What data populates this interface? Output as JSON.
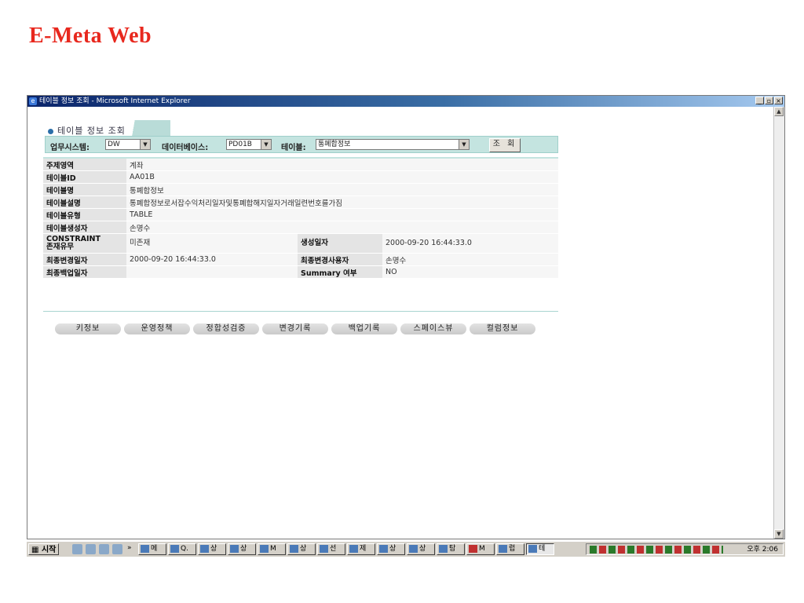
{
  "slide": {
    "title": "E-Meta Web"
  },
  "window": {
    "title": "테이블 정보 조회 - Microsoft Internet Explorer",
    "controls": {
      "minimize": "_",
      "maximize": "▫",
      "close": "×"
    }
  },
  "section": {
    "title": "테이블 정보 조회"
  },
  "search": {
    "system_label": "업무시스템:",
    "system_value": "DW",
    "db_label": "데이터베이스:",
    "db_value": "PD01B",
    "table_label": "테이블:",
    "table_value": "통폐합정보",
    "query_button": "조 회"
  },
  "info": {
    "subject_area": {
      "label": "주제영역",
      "value": "계좌"
    },
    "table_id": {
      "label": "테이블ID",
      "value": "AA01B"
    },
    "table_name": {
      "label": "테이블명",
      "value": "통폐합정보"
    },
    "table_desc": {
      "label": "테이블설명",
      "value": "통폐합정보로서잡수익처리일자및통폐합해지일자거래일련번호를가짐"
    },
    "table_type": {
      "label": "테이블유형",
      "value": "TABLE"
    },
    "creator": {
      "label": "테이블생성자",
      "value": "손명수"
    },
    "constraint": {
      "label_line1": "CONSTRAINT",
      "label_line2": "존재유무",
      "value": "미존재"
    },
    "created_date": {
      "label": "생성일자",
      "value": "2000-09-20 16:44:33.0"
    },
    "modified_date": {
      "label": "최종변경일자",
      "value": "2000-09-20 16:44:33.0"
    },
    "modified_user": {
      "label": "최종변경사용자",
      "value": "손명수"
    },
    "backup_date": {
      "label": "최종백업일자",
      "value": ""
    },
    "summary": {
      "label": "Summary 여부",
      "value": "NO"
    }
  },
  "tabs": [
    "키정보",
    "운영정책",
    "정합성검증",
    "변경기록",
    "백업기록",
    "스페이스뷰",
    "컬럼정보"
  ],
  "taskbar": {
    "start": "시작",
    "more": "»",
    "items": [
      "메",
      "Q.",
      "상",
      "상",
      "M",
      "상",
      "선",
      "제",
      "상",
      "상",
      "탐",
      "M",
      "럽",
      "테"
    ],
    "clock": "오후 2:06"
  }
}
